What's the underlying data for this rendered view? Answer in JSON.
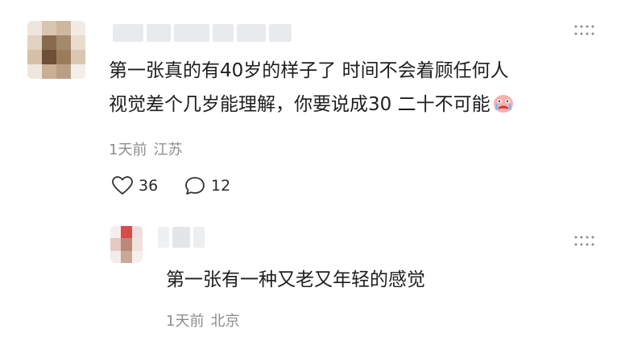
{
  "comment": {
    "text_line1": "第一张真的有40岁的样子了 时间不会着顾任何人",
    "text_line2": "视觉差个几岁能理解，你要说成30 二十不可能",
    "emoji": "crying-face-emoji",
    "time": "1天前",
    "location": "江苏",
    "likes": "36",
    "replies": "12",
    "more_label": "⋮⋮"
  },
  "reply": {
    "text": "第一张有一种又老又年轻的感觉",
    "time": "1天前",
    "location": "北京",
    "more_label": "⋮⋮"
  },
  "colors": {
    "text": "#1e1e1e",
    "meta": "#8d8d8d",
    "background": "#ffffff"
  }
}
